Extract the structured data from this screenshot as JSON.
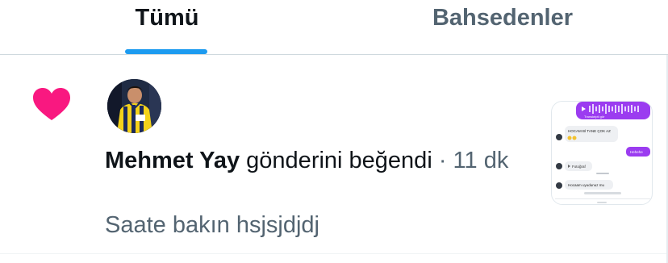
{
  "tabs": {
    "all": "Tümü",
    "mentions": "Bahsedenler"
  },
  "notification": {
    "type_icon": "heart-icon",
    "actor": "Mehmet Yay",
    "action": "gönderini beğendi",
    "time": "· 11 dk",
    "snippet": "Saate bakın hsjsjdjdj",
    "media_thumbnail": {
      "lines": [
        "Transkripti gör",
        "HOCAM Bİ TANE ÇOK AZ",
        "Hehehe",
        "Fotoğraf",
        "Hocaam uyudunuz mu"
      ]
    }
  },
  "colors": {
    "accent": "#1d9bf0",
    "like": "#f91880",
    "muted_text": "#536471",
    "chat_purple": "#9b3cf0"
  }
}
